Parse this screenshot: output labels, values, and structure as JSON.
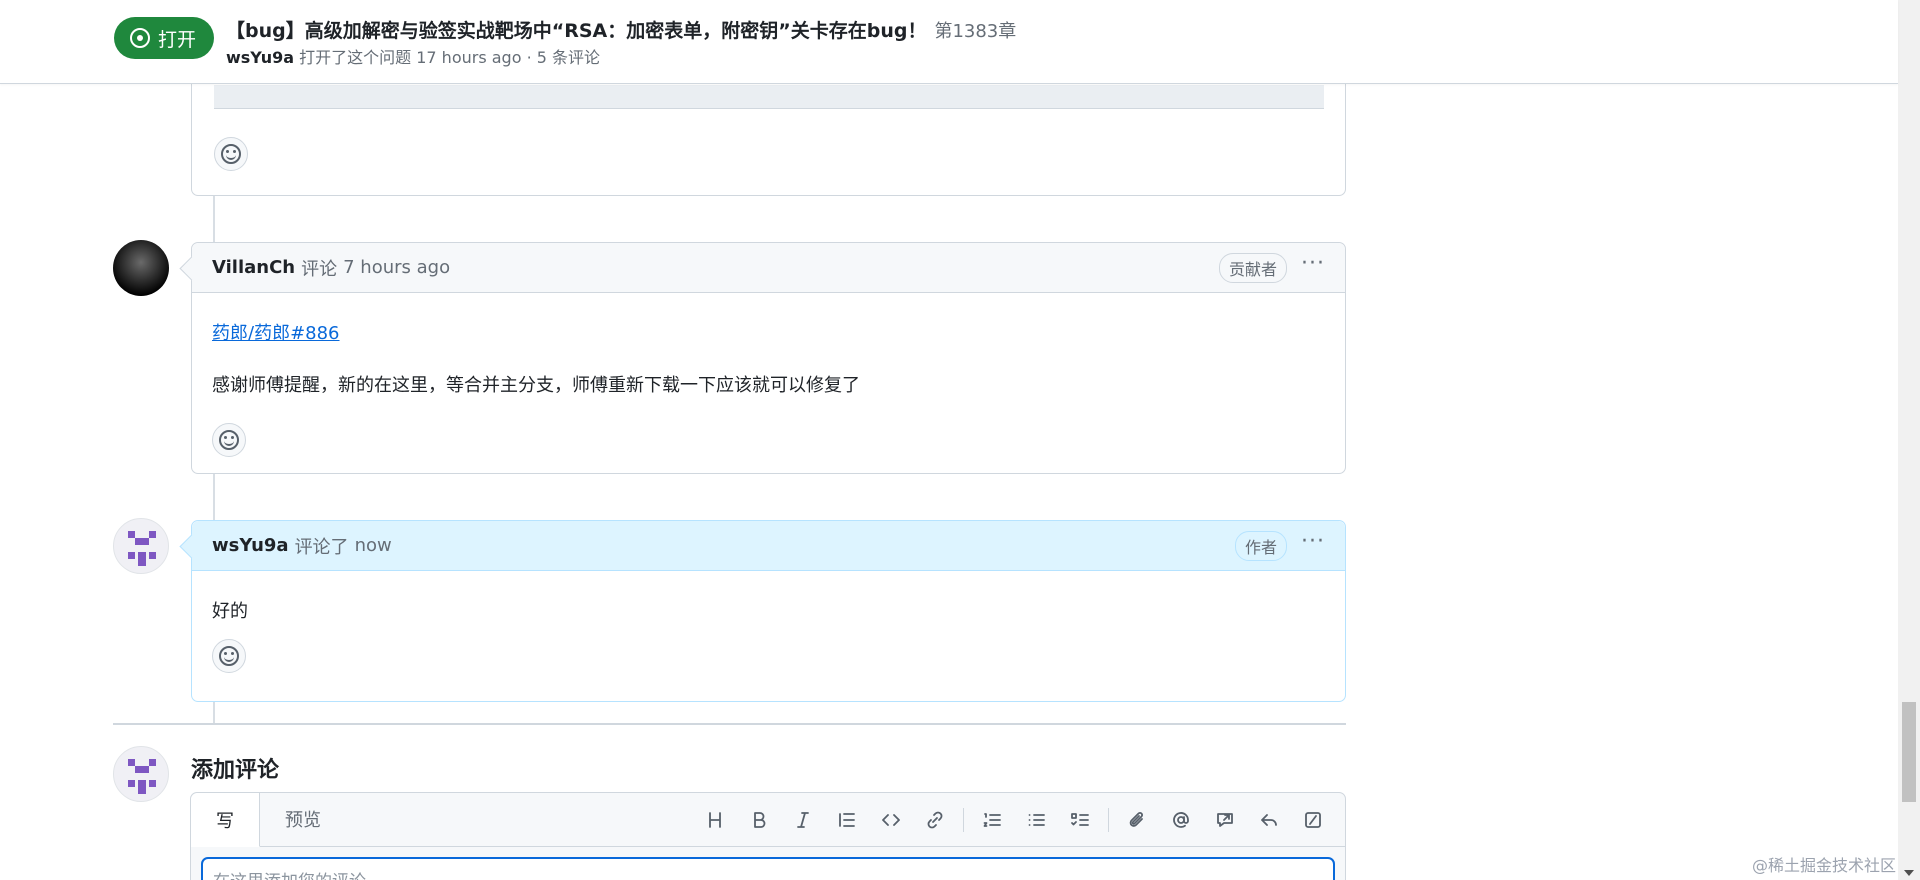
{
  "header": {
    "state_label": "打开",
    "title": "【bug】高级加解密与验签实战靶场中“RSA：加密表单，附密钥”关卡存在bug！",
    "number": "第1383章",
    "meta_author": "wsYu9a",
    "meta_text": "打开了这个问题 17 hours ago · 5 条评论"
  },
  "comments": [
    {
      "author": "VillanCh",
      "action": "评论",
      "time": "7 hours ago",
      "role": "贡献者",
      "link": "药郎/药郎#886",
      "text": "感谢师傅提醒，新的在这里，等合并主分支，师傅重新下载一下应该就可以修复了"
    },
    {
      "author": "wsYu9a",
      "action": "评论了",
      "time": "now",
      "role": "作者",
      "text": "好的"
    }
  ],
  "add_comment": {
    "title": "添加评论",
    "tab_write": "写",
    "tab_preview": "预览",
    "placeholder": "在这里添加您的评论..."
  },
  "toolbar_icons": [
    "heading-icon",
    "bold-icon",
    "italic-icon",
    "quote-icon",
    "code-icon",
    "link-icon",
    "ordered-list-icon",
    "unordered-list-icon",
    "task-list-icon",
    "attach-icon",
    "mention-icon",
    "reference-icon",
    "reply-icon",
    "slash-command-icon"
  ],
  "watermark": "@稀土掘金技术社区",
  "colors": {
    "open_green": "#1f883d",
    "link_blue": "#0969da",
    "author_bg": "#ddf4ff"
  }
}
